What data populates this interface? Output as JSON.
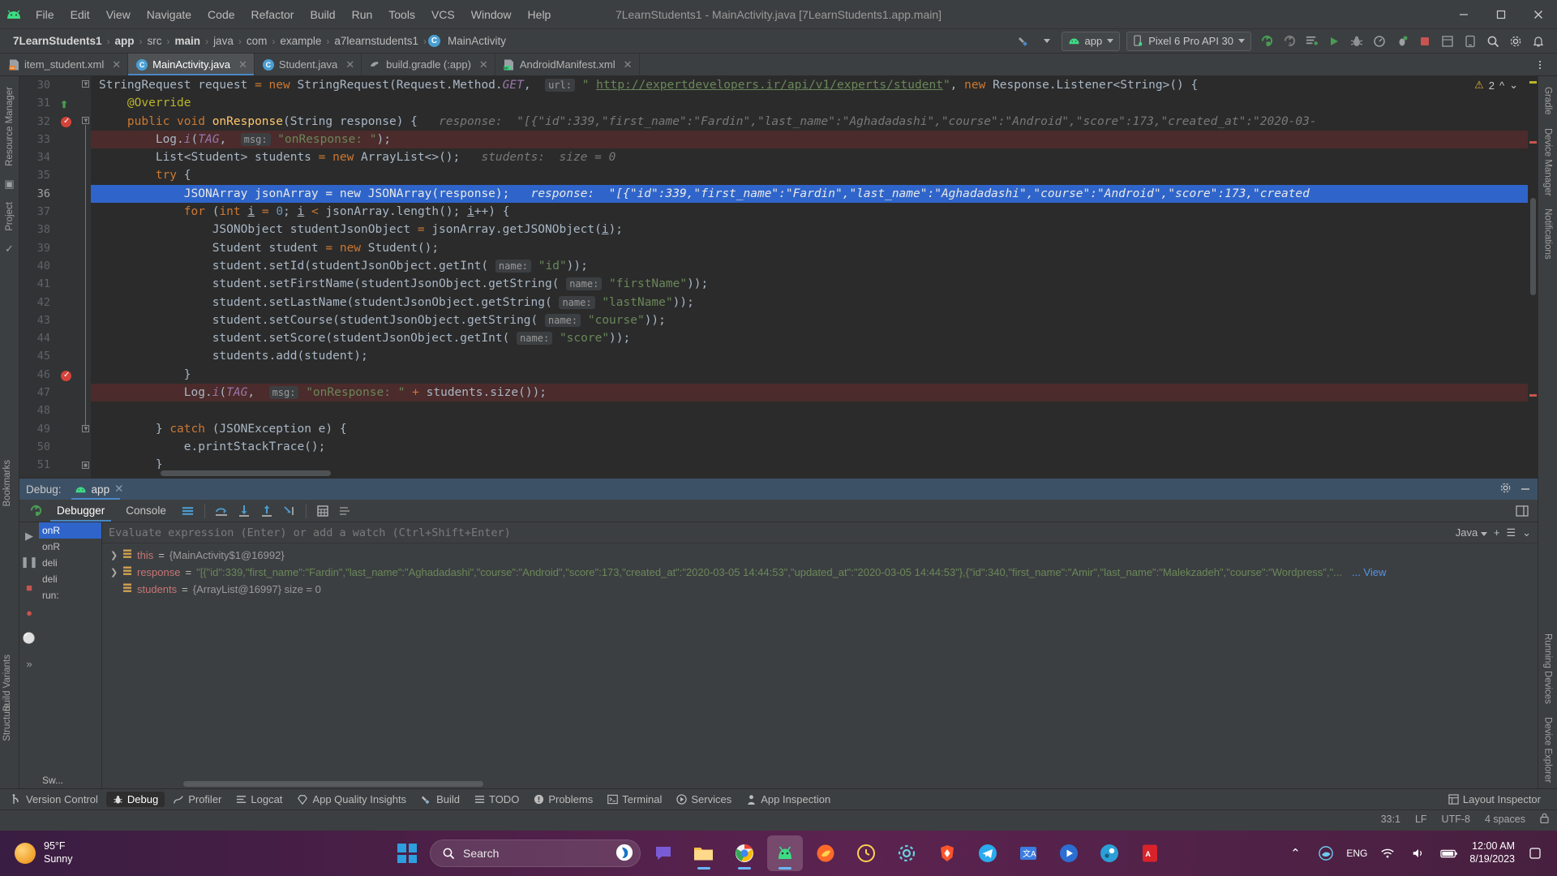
{
  "window": {
    "title": "7LearnStudents1 - MainActivity.java [7LearnStudents1.app.main]",
    "minimize": "—",
    "maximize": "❐",
    "close": "✕"
  },
  "menu": {
    "items": [
      "File",
      "Edit",
      "View",
      "Navigate",
      "Code",
      "Refactor",
      "Build",
      "Run",
      "Tools",
      "VCS",
      "Window",
      "Help"
    ]
  },
  "breadcrumb": {
    "items": [
      "7LearnStudents1",
      "app",
      "src",
      "main",
      "java",
      "com",
      "example",
      "a7learnstudents1",
      "MainActivity"
    ],
    "separator": "›",
    "class_icon_letter": "C"
  },
  "toolbar": {
    "build_variant_label": "",
    "run_config": "app",
    "device": "Pixel 6 Pro API 30",
    "icons": [
      "hammer-icon",
      "chevron-down-icon",
      "run-config-combo",
      "device-combo",
      "run-icon",
      "debug-icon",
      "run-with-coverage-icon",
      "profile-icon",
      "apply-changes-icon",
      "attach-debugger-icon",
      "stop-icon",
      "search-everywhere-icon",
      "settings-icon",
      "notifications-icon"
    ]
  },
  "editor_tabs": [
    {
      "label": "item_student.xml",
      "icon": "xml-file-icon",
      "active": false
    },
    {
      "label": "MainActivity.java",
      "icon": "java-class-icon",
      "active": true
    },
    {
      "label": "Student.java",
      "icon": "java-class-icon",
      "active": false
    },
    {
      "label": "build.gradle (:app)",
      "icon": "gradle-file-icon",
      "active": false
    },
    {
      "label": "AndroidManifest.xml",
      "icon": "manifest-file-icon",
      "active": false
    }
  ],
  "editor": {
    "warning_count": "2",
    "line_numbers": [
      "30",
      "31",
      "32",
      "33",
      "34",
      "35",
      "36",
      "37",
      "38",
      "39",
      "40",
      "41",
      "42",
      "43",
      "44",
      "45",
      "46",
      "47",
      "48",
      "49",
      "50",
      "51"
    ],
    "lines": [
      {
        "no": "30",
        "html": "<span class=\"ident\">StringRequest request</span> <span class=\"kw\">=</span> <span class=\"kw\">new</span> <span class=\"ident\">StringRequest(</span><span class=\"ident\">Request</span><span class=\"ident\">.</span><span class=\"ident\">Method</span><span class=\"ident\">.</span><span class=\"stat\">GET</span><span class=\"ident\">,</span>  <span class=\"pbadge\">url:</span> <span class=\"str\">\" </span><span class=\"lnk\">http://expertdevelopers.ir/api/v1/experts/student</span><span class=\"str\">\"</span><span class=\"ident\">, </span><span class=\"kw\">new</span> <span class=\"ident\">Response.Listener&lt;String&gt;() {</span>",
        "highlight": "none"
      },
      {
        "no": "31",
        "html": "    <span class=\"ann\">@Override</span>",
        "highlight": "none"
      },
      {
        "no": "32",
        "html": "    <span class=\"kw\">public</span> <span class=\"kw\">void</span> <span class=\"fn\">onResponse</span><span class=\"ident\">(String response) {</span>   <span class=\"hint\">response:</span>  <span class=\"hint\">\"[{\"id\":339,\"first_name\":\"Fardin\",\"last_name\":\"Aghadadashi\",\"course\":\"Android\",\"score\":173,\"created_at\":\"2020-03-</span>",
        "highlight": "none"
      },
      {
        "no": "33",
        "html": "        <span class=\"ident\">Log.</span><span class=\"stat\">i</span><span class=\"ident\">(</span><span class=\"stat\">TAG</span><span class=\"ident\">,</span>  <span class=\"pbadge\">msg:</span> <span class=\"str\">\"onResponse: \"</span><span class=\"ident\">);</span>",
        "highlight": "red"
      },
      {
        "no": "34",
        "html": "        <span class=\"ident\">List&lt;Student&gt; students</span> <span class=\"kw\">=</span> <span class=\"kw\">new</span> <span class=\"ident\">ArrayList&lt;&gt;();</span>   <span class=\"hint\">students:</span>  <span class=\"hint\">size = 0</span>",
        "highlight": "none"
      },
      {
        "no": "35",
        "html": "        <span class=\"kw\">try</span> <span class=\"ident\">{</span>",
        "highlight": "none"
      },
      {
        "no": "36",
        "html": "            <span class=\"ident\">JSONArray jsonArray</span> <span class=\"kw\">=</span> <span class=\"kw\">new</span> <span class=\"ident\">JSONArray(response);</span>   <span class=\"hint\">response:</span>  <span class=\"hint\">\"[{\"id\":339,\"first_name\":\"Fardin\",\"last_name\":\"Aghadadashi\",\"course\":\"Android\",\"score\":173,\"created</span>",
        "highlight": "blue"
      },
      {
        "no": "37",
        "html": "            <span class=\"kw\">for</span> <span class=\"ident\">(</span><span class=\"kw\">int</span> <span class=\"ident uline\">i</span> <span class=\"kw\">=</span> <span class=\"num\">0</span><span class=\"ident\">;</span> <span class=\"ident uline\">i</span> <span class=\"kw\">&lt;</span> <span class=\"ident\">jsonArray.length();</span> <span class=\"ident uline\">i</span><span class=\"ident\">++) {</span>",
        "highlight": "none"
      },
      {
        "no": "38",
        "html": "                <span class=\"ident\">JSONObject studentJsonObject</span> <span class=\"kw\">=</span> <span class=\"ident\">jsonArray.getJSONObject(</span><span class=\"ident uline\">i</span><span class=\"ident\">);</span>",
        "highlight": "none"
      },
      {
        "no": "39",
        "html": "                <span class=\"ident\">Student student</span> <span class=\"kw\">=</span> <span class=\"kw\">new</span> <span class=\"ident\">Student();</span>",
        "highlight": "none"
      },
      {
        "no": "40",
        "html": "                <span class=\"ident\">student.setId(studentJsonObject.getInt(</span> <span class=\"pbadge\">name:</span> <span class=\"str\">\"id\"</span><span class=\"ident\">));</span>",
        "highlight": "none"
      },
      {
        "no": "41",
        "html": "                <span class=\"ident\">student.setFirstName(studentJsonObject.getString(</span> <span class=\"pbadge\">name:</span> <span class=\"str\">\"firstName\"</span><span class=\"ident\">));</span>",
        "highlight": "none"
      },
      {
        "no": "42",
        "html": "                <span class=\"ident\">student.setLastName(studentJsonObject.getString(</span> <span class=\"pbadge\">name:</span> <span class=\"str\">\"lastName\"</span><span class=\"ident\">));</span>",
        "highlight": "none"
      },
      {
        "no": "43",
        "html": "                <span class=\"ident\">student.setCourse(studentJsonObject.getString(</span> <span class=\"pbadge\">name:</span> <span class=\"str\">\"course\"</span><span class=\"ident\">));</span>",
        "highlight": "none"
      },
      {
        "no": "44",
        "html": "                <span class=\"ident\">student.setScore(studentJsonObject.getInt(</span> <span class=\"pbadge\">name:</span> <span class=\"str\">\"score\"</span><span class=\"ident\">));</span>",
        "highlight": "none"
      },
      {
        "no": "45",
        "html": "                <span class=\"ident\">students.add(student);</span>",
        "highlight": "none"
      },
      {
        "no": "46",
        "html": "            <span class=\"ident\">}</span>",
        "highlight": "none"
      },
      {
        "no": "47",
        "html": "            <span class=\"ident\">Log.</span><span class=\"stat\">i</span><span class=\"ident\">(</span><span class=\"stat\">TAG</span><span class=\"ident\">,</span>  <span class=\"pbadge\">msg:</span> <span class=\"str\">\"onResponse: \"</span> <span class=\"kw\">+</span> <span class=\"ident\">students.size());</span>",
        "highlight": "red"
      },
      {
        "no": "48",
        "html": "",
        "highlight": "none"
      },
      {
        "no": "49",
        "html": "        <span class=\"ident\">}</span> <span class=\"kw\">catch</span> <span class=\"ident\">(JSONException e) {</span>",
        "highlight": "none"
      },
      {
        "no": "50",
        "html": "            <span class=\"ident\">e.printStackTrace();</span>",
        "highlight": "none"
      },
      {
        "no": "51",
        "html": "        <span class=\"ident\">}</span>",
        "highlight": "none"
      }
    ]
  },
  "left_strip": {
    "items": [
      "Resource Manager",
      "Project"
    ]
  },
  "right_strip": {
    "items": [
      "Gradle",
      "Device Manager",
      "Notifications",
      "Running Devices",
      "Device Explorer"
    ]
  },
  "bookmarks_strip": {
    "items": [
      "Bookmarks",
      "Structure"
    ]
  },
  "debug_strip": {
    "items": [
      "Build Variants"
    ]
  },
  "debug": {
    "header_label": "Debug:",
    "session_tab": "app",
    "tabs": [
      "Debugger",
      "Console"
    ],
    "active_tab": "Debugger",
    "evaluate_placeholder": "Evaluate expression (Enter) or add a watch (Ctrl+Shift+Enter)",
    "language_label": "Java",
    "frames": [
      "onR",
      "onR",
      "deli",
      "deli",
      "run:",
      "Sw..."
    ],
    "selected_frame": "onR",
    "variables": [
      {
        "expandable": true,
        "name": "this",
        "value": "{MainActivity$1@16992}",
        "value_style": "gray",
        "extra": ""
      },
      {
        "expandable": true,
        "name": "response",
        "value": "\"[{\"id\":339,\"first_name\":\"Fardin\",\"last_name\":\"Aghadadashi\",\"course\":\"Android\",\"score\":173,\"created_at\":\"2020-03-05 14:44:53\",\"updated_at\":\"2020-03-05 14:44:53\"},{\"id\":340,\"first_name\":\"Amir\",\"last_name\":\"Malekzadeh\",\"course\":\"Wordpress\",\"...",
        "value_style": "green",
        "extra": "View"
      },
      {
        "expandable": false,
        "name": "students",
        "value": "{ArrayList@16997}  size = 0",
        "value_style": "gray",
        "extra": ""
      }
    ]
  },
  "bottom_tools": [
    {
      "label": "Version Control",
      "icon": "branch-icon",
      "active": false
    },
    {
      "label": "Debug",
      "icon": "bug-icon",
      "active": true
    },
    {
      "label": "Profiler",
      "icon": "profiler-icon",
      "active": false
    },
    {
      "label": "Logcat",
      "icon": "logcat-icon",
      "active": false
    },
    {
      "label": "App Quality Insights",
      "icon": "diamond-icon",
      "active": false
    },
    {
      "label": "Build",
      "icon": "hammer-icon",
      "active": false
    },
    {
      "label": "TODO",
      "icon": "todo-icon",
      "active": false
    },
    {
      "label": "Problems",
      "icon": "problems-icon",
      "active": false
    },
    {
      "label": "Terminal",
      "icon": "terminal-icon",
      "active": false
    },
    {
      "label": "Services",
      "icon": "services-icon",
      "active": false
    },
    {
      "label": "App Inspection",
      "icon": "app-inspection-icon",
      "active": false
    }
  ],
  "bottom_right": {
    "layout_inspector": "Layout Inspector"
  },
  "statusbar": {
    "caret": "33:1",
    "line_sep": "LF",
    "encoding": "UTF-8",
    "indent": "4 spaces"
  },
  "taskbar": {
    "weather_temp": "95°F",
    "weather_desc": "Sunny",
    "search_placeholder": "Search",
    "apps": [
      "start-icon",
      "search-box",
      "copilot-icon",
      "chat-icon",
      "file-explorer-icon",
      "chrome-icon",
      "android-studio-icon",
      "edge-dev-icon",
      "firefox-icon",
      "clock-app-icon",
      "settings-icon",
      "brave-icon",
      "telegram-icon",
      "translate-icon",
      "media-player-icon",
      "steam-icon",
      "acrobat-icon"
    ],
    "tray": {
      "chevron": "⌃",
      "lang": "ENG",
      "time": "12:00 AM",
      "date": "8/19/2023"
    }
  }
}
